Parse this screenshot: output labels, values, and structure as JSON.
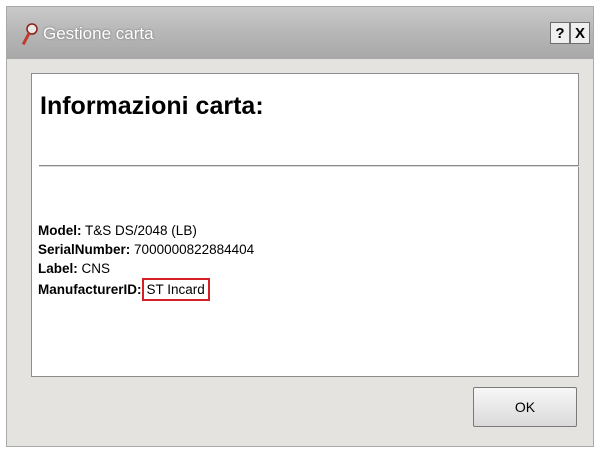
{
  "window": {
    "title": "Gestione carta",
    "help_label": "?",
    "close_label": "X",
    "title_icon": "key-icon"
  },
  "panel": {
    "heading": "Informazioni carta:",
    "fields": [
      {
        "key": "Model:",
        "value": "T&S DS/2048 (LB)"
      },
      {
        "key": "SerialNumber:",
        "value": "7000000822884404"
      },
      {
        "key": "Label:",
        "value": "CNS"
      },
      {
        "key": "ManufacturerID:",
        "value": "ST Incard"
      }
    ]
  },
  "buttons": {
    "ok_label": "OK"
  },
  "colors": {
    "highlight_border": "#d42027",
    "titlebar": "#b8b8b8",
    "window_bg": "#e4e3e0"
  }
}
